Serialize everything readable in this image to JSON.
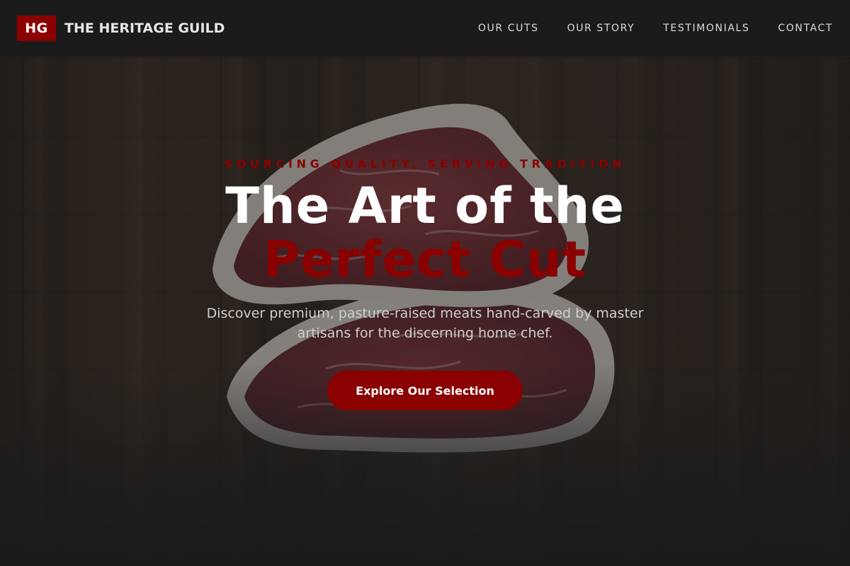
{
  "header": {
    "logo_badge": "HG",
    "logo_name": "THE HERITAGE GUILD",
    "nav": [
      {
        "label": "OUR CUTS"
      },
      {
        "label": "OUR STORY"
      },
      {
        "label": "TESTIMONIALS"
      },
      {
        "label": "CONTACT"
      }
    ]
  },
  "hero": {
    "eyebrow": "SOURCING QUALITY, SERVING TRADITION",
    "headline_line1": "The Art of the",
    "headline_line2": "Perfect Cut",
    "subtitle": "Discover premium, pasture-raised meats hand-carved by master artisans for the discerning home chef.",
    "cta_label": "Explore Our Selection",
    "background_image": "steak-on-wooden-board"
  },
  "colors": {
    "accent": "#8b0000",
    "background": "#1b1b1b",
    "nav_text": "#dcdcdc",
    "subtitle_text": "#cfcfcf"
  }
}
